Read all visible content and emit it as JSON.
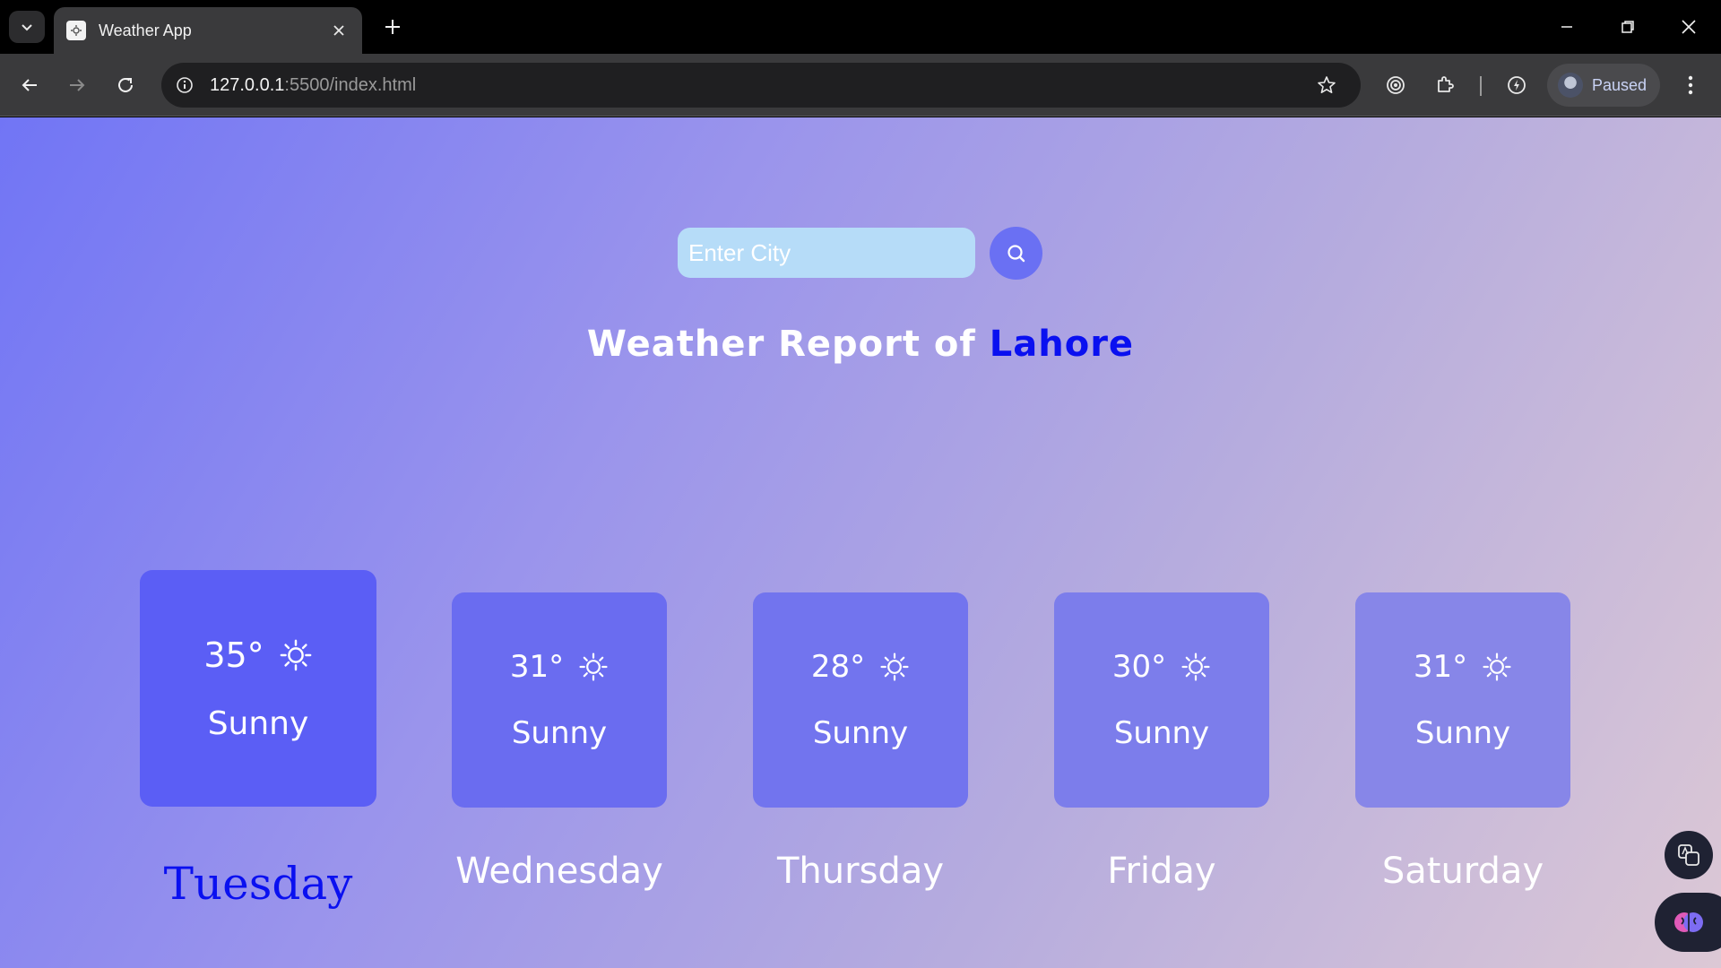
{
  "browser": {
    "tab_title": "Weather App",
    "url_host": "127.0.0.1",
    "url_rest": ":5500/index.html",
    "profile_status": "Paused"
  },
  "search": {
    "placeholder": "Enter City"
  },
  "heading": {
    "prefix": "Weather Report of",
    "city": "Lahore"
  },
  "forecast": [
    {
      "temp": "35°",
      "condition": "Sunny",
      "day": "Tuesday",
      "active": true
    },
    {
      "temp": "31°",
      "condition": "Sunny",
      "day": "Wednesday",
      "active": false
    },
    {
      "temp": "28°",
      "condition": "Sunny",
      "day": "Thursday",
      "active": false
    },
    {
      "temp": "30°",
      "condition": "Sunny",
      "day": "Friday",
      "active": false
    },
    {
      "temp": "31°",
      "condition": "Sunny",
      "day": "Saturday",
      "active": false
    }
  ],
  "colors": {
    "card_active": "#5b5ef5",
    "card_1": "#6a6cf0",
    "card_2": "#7274ee",
    "card_3": "#7c7deb",
    "card_4": "#8786e8",
    "day_active": "#0a10f0",
    "city": "#0a10f0"
  },
  "icons": {
    "weather": "sun-icon"
  }
}
